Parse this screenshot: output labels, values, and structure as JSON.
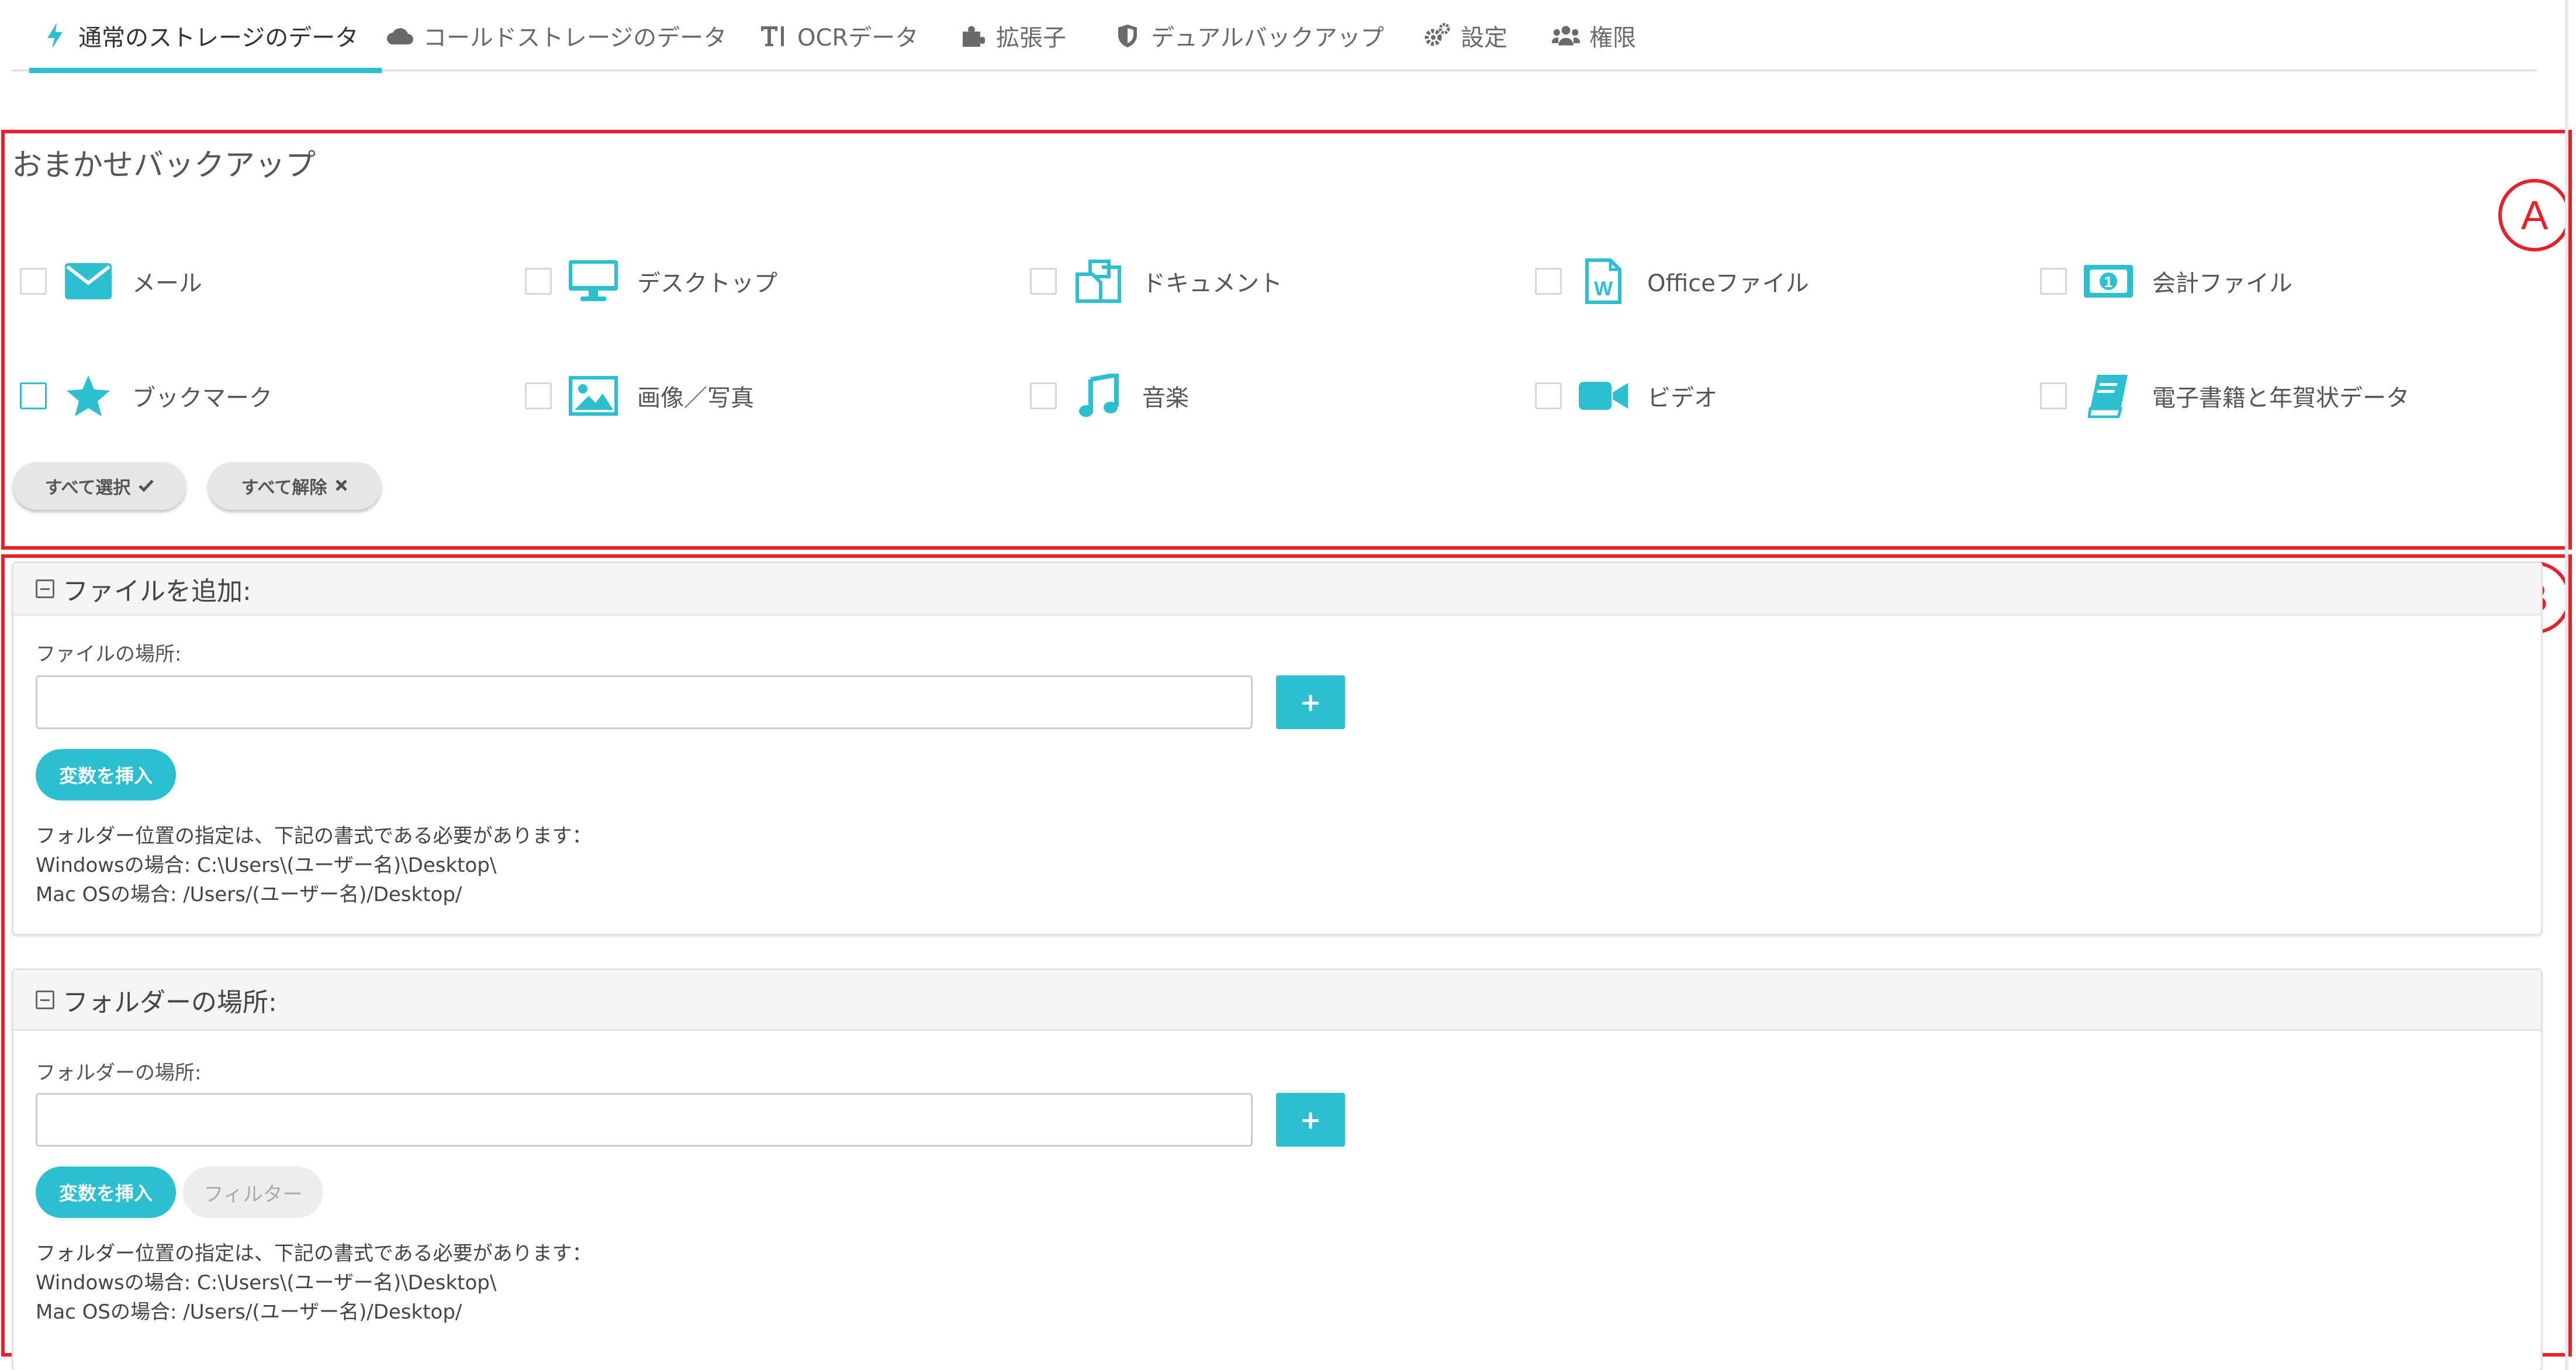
{
  "tabs": [
    {
      "label": "通常のストレージのデータ",
      "icon": "bolt-icon",
      "active": true
    },
    {
      "label": "コールドストレージのデータ",
      "icon": "cloud-icon"
    },
    {
      "label": "OCRデータ",
      "icon": "text-icon"
    },
    {
      "label": "拡張子",
      "icon": "puzzle-icon"
    },
    {
      "label": "デュアルバックアップ",
      "icon": "shield-icon"
    },
    {
      "label": "設定",
      "icon": "gears-icon"
    },
    {
      "label": "権限",
      "icon": "users-icon"
    }
  ],
  "callouts": {
    "a": "A",
    "b": "B"
  },
  "auto_backup": {
    "title": "おまかせバックアップ",
    "categories": [
      {
        "label": "メール",
        "icon": "envelope-icon",
        "checked": false
      },
      {
        "label": "デスクトップ",
        "icon": "desktop-icon",
        "checked": false
      },
      {
        "label": "ドキュメント",
        "icon": "documents-icon",
        "checked": false
      },
      {
        "label": "Officeファイル",
        "icon": "word-file-icon",
        "checked": false
      },
      {
        "label": "会計ファイル",
        "icon": "money-icon",
        "checked": false
      },
      {
        "label": "ブックマーク",
        "icon": "star-icon",
        "checked": false
      },
      {
        "label": "画像／写真",
        "icon": "image-icon",
        "checked": false
      },
      {
        "label": "音楽",
        "icon": "music-icon",
        "checked": false
      },
      {
        "label": "ビデオ",
        "icon": "video-icon",
        "checked": false
      },
      {
        "label": "電子書籍と年賀状データ",
        "icon": "book-icon",
        "checked": false
      }
    ],
    "select_all_label": "すべて選択",
    "deselect_all_label": "すべて解除"
  },
  "add_file": {
    "title": "ファイルを追加:",
    "field_label": "ファイルの場所:",
    "value": "",
    "add_button": "+",
    "insert_var_label": "変数を挿入",
    "note_lines": [
      "フォルダー位置の指定は、下記の書式である必要があります：",
      "Windowsの場合: C:\\Users\\(ユーザー名)\\Desktop\\",
      "Mac OSの場合: /Users/(ユーザー名)/Desktop/"
    ]
  },
  "folder_location": {
    "title": "フォルダーの場所:",
    "field_label": "フォルダーの場所:",
    "value": "",
    "add_button": "+",
    "insert_var_label": "変数を挿入",
    "filter_label": "フィルター",
    "note_lines": [
      "フォルダー位置の指定は、下記の書式である必要があります：",
      "Windowsの場合: C:\\Users\\(ユーザー名)\\Desktop\\",
      "Mac OSの場合: /Users/(ユーザー名)/Desktop/"
    ]
  },
  "colors": {
    "accent": "#2cbfd0",
    "callout": "#e8202a"
  }
}
